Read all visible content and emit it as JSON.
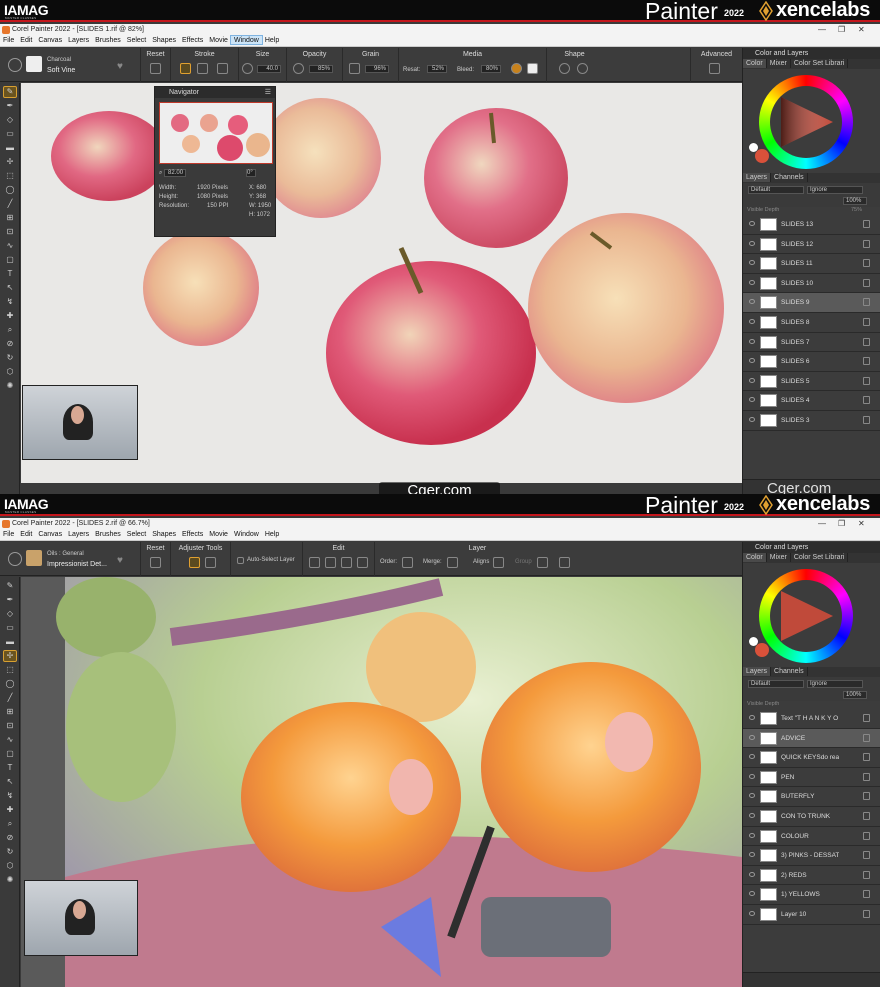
{
  "brand": {
    "iamag": "IAMAG",
    "iamag_sub": "MASTER CLASSES",
    "painter": "Painter",
    "year": "2022",
    "xencelabs": "xencelabs"
  },
  "top": {
    "window_title": "Corel Painter 2022 - [SLIDES 1.rif @ 82%]",
    "menu": [
      "File",
      "Edit",
      "Canvas",
      "Layers",
      "Brushes",
      "Select",
      "Shapes",
      "Effects",
      "Movie",
      "Window",
      "Help"
    ],
    "active_menu": "Window",
    "brush": {
      "category": "Charcoal",
      "variant": "Soft Vine"
    },
    "props": {
      "reset": "Reset",
      "stroke": "Stroke",
      "size": "Size",
      "size_val": "40.0",
      "opacity": "Opacity",
      "opacity_val": "85%",
      "grain": "Grain",
      "grain_val": "96%",
      "media": "Media",
      "resat": "Resat:",
      "resat_val": "52%",
      "bleed": "Bleed:",
      "bleed_val": "80%",
      "shape": "Shape",
      "advanced": "Advanced"
    },
    "navigator": {
      "title": "Navigator",
      "zoom": "82.00",
      "rotation": "0°",
      "width_label": "Width:",
      "width": "1920 Pixels",
      "height_label": "Height:",
      "height": "1080 Pixels",
      "res_label": "Resolution:",
      "res": "150 PPI",
      "x_label": "X:",
      "x": "680",
      "y_label": "Y:",
      "y": "368",
      "w_label": "W:",
      "w": "1950",
      "h_label": "H:",
      "h": "1072"
    },
    "panel": {
      "title": "Color and Layers",
      "tabs": [
        "Color",
        "Mixer",
        "Color Set Librari"
      ],
      "layer_tabs": [
        "Layers",
        "Channels"
      ],
      "composite": "Default",
      "mode": "Ignore",
      "opacity": "100%",
      "visible_depth": "Visible Depth",
      "depth_val": "75%",
      "layers": [
        "SLIDES 13",
        "SLIDES 12",
        "SLIDES 11",
        "SLIDES 10",
        "SLIDES 9",
        "SLIDES 8",
        "SLIDES 7",
        "SLIDES 6",
        "SLIDES 5",
        "SLIDES 4",
        "SLIDES 3"
      ],
      "selected": "SLIDES 9"
    }
  },
  "bottom": {
    "window_title": "Corel Painter 2022 - [SLIDES 2.rif @ 66.7%]",
    "menu": [
      "File",
      "Edit",
      "Canvas",
      "Layers",
      "Brushes",
      "Select",
      "Shapes",
      "Effects",
      "Movie",
      "Window",
      "Help"
    ],
    "brush": {
      "category": "Oils : General",
      "variant": "Impressionist Det..."
    },
    "props": {
      "reset": "Reset",
      "adjuster": "Adjuster Tools",
      "auto_select": "Auto-Select Layer",
      "edit": "Edit",
      "layer": "Layer",
      "order": "Order:",
      "merge": "Merge:",
      "align": "Aligns",
      "group": "Group"
    },
    "panel": {
      "title": "Color and Layers",
      "tabs": [
        "Color",
        "Mixer",
        "Color Set Librari"
      ],
      "layer_tabs": [
        "Layers",
        "Channels"
      ],
      "composite": "Default",
      "mode": "Ignore",
      "opacity": "100%",
      "visible_depth": "Visible Depth",
      "layers": [
        "Text \"T H A N K  Y O",
        "ADVICE",
        "QUICK KEYSdo realisi",
        "PEN",
        "BUTERFLY",
        "CON TO TRUNK",
        "COLOUR",
        "3) PINKS - DESSAT",
        "2) REDS",
        "1) YELLOWS",
        "Layer 10"
      ],
      "selected": "ADVICE"
    }
  },
  "watermark": "Cger.com",
  "colors": {
    "accent": "#c4161c",
    "selected_tool": "#d9a030",
    "main_color": "#d9513a"
  }
}
